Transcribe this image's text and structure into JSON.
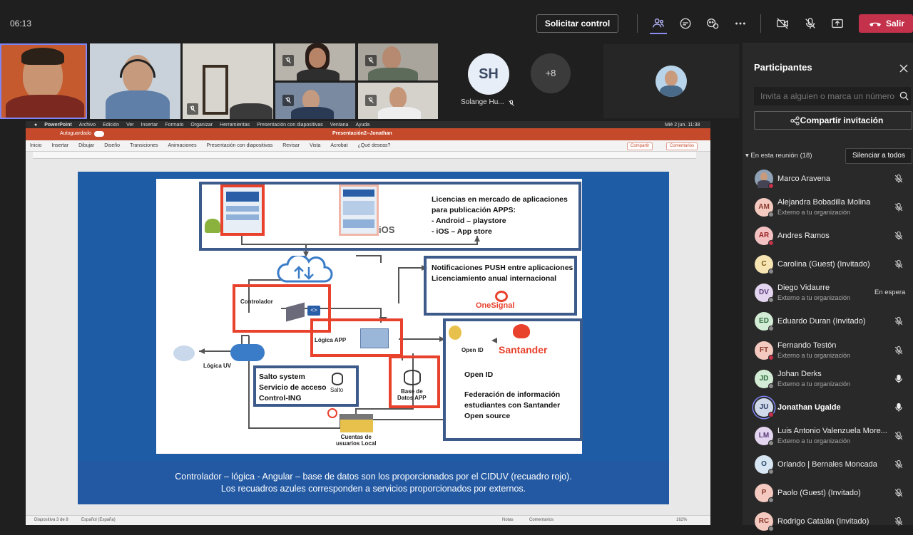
{
  "call": {
    "elapsed": "06:13",
    "request_control_label": "Solicitar control",
    "leave_label": "Salir"
  },
  "video_strip": {
    "shared_avatar_initials": "SH",
    "shared_avatar_name": "Solange Hu...",
    "more_count": "+8"
  },
  "screen_share": {
    "mac_menu": [
      "PowerPoint",
      "Archivo",
      "Edición",
      "Ver",
      "Insertar",
      "Formato",
      "Organizar",
      "Herramientas",
      "Presentación con diapositivas",
      "Ventana",
      "Ayuda"
    ],
    "clock": "Mié 2 jun.  11:38",
    "autosave_label": "Autoguardado",
    "document_title": "Presentación2--Jonathan",
    "ribbon_tabs": [
      "Inicio",
      "Insertar",
      "Dibujar",
      "Diseño",
      "Transiciones",
      "Animaciones",
      "Presentación con diapositivas",
      "Revisar",
      "Vista",
      "Acrobat",
      "¿Qué deseas?"
    ],
    "share_label": "Compartir",
    "comments_label": "Comentarios",
    "status_slide": "Diapositiva 3 de 8",
    "status_language": "Español (España)",
    "status_notes": "Notas",
    "status_comments": "Comentarios",
    "zoom": "162%"
  },
  "slide": {
    "apps_title": "Licencias en mercado de aplicaciones",
    "apps_title2": "para publicación APPS:",
    "apps_item1": "-   Android – playstore",
    "apps_item2": "-   iOS – App store",
    "ios_label": "iOS",
    "push_line1": "Notificaciones PUSH entre aplicaciones",
    "push_line2": "Licenciamiento anual internacional",
    "onesignal_label": "OneSignal",
    "controller_label": "Controlador",
    "logic_app_label": "Lógica APP",
    "open_id_small": "Open ID",
    "santander_label": "Santander",
    "logic_uv_label": "Lógica UV",
    "salto_line1": "Salto system",
    "salto_line2": "Servicio de acceso",
    "salto_line3": "Control-ING",
    "salto_db": "Salto",
    "db_app_line1": "Base de",
    "db_app_line2": "Datos APP",
    "openid_line": "Open ID",
    "fed_line1": "Federación de información",
    "fed_line2": "estudiantes con Santander",
    "fed_line3": "Open source",
    "local_users_line1": "Cuentas de",
    "local_users_line2": "usuarios Local",
    "footer_line1": "Controlador – lógica - Angular – base de datos son los proporcionados por el CIDUV (recuadro rojo).",
    "footer_line2": "Los recuadros azules corresponden a servicios proporcionados por externos."
  },
  "participants": {
    "title": "Participantes",
    "invite_placeholder": "Invita a alguien o marca un número",
    "share_invite_label": "Compartir invitación",
    "section_label": "En esta reunión (18)",
    "mute_all_label": "Silenciar a todos",
    "list": [
      {
        "name": "Marco Aravena",
        "initials": "",
        "subtitle": "",
        "photo": true,
        "avatar_color": "#8fa2b5",
        "status_color": "#c4314b",
        "mic": "muted"
      },
      {
        "name": "Alejandra Bobadilla Molina",
        "initials": "AM",
        "subtitle": "Externo a tu organización",
        "avatar_color": "#f3c9c0",
        "text_color": "#8a3a2c",
        "status_color": "#8a8a8a",
        "mic": "muted"
      },
      {
        "name": "Andres Ramos",
        "initials": "AR",
        "subtitle": "",
        "avatar_color": "#f3c1c1",
        "text_color": "#922",
        "status_color": "#c4314b",
        "mic": "muted"
      },
      {
        "name": "Carolina (Guest) (Invitado)",
        "initials": "C",
        "subtitle": "",
        "avatar_color": "#f6e5b3",
        "text_color": "#7a5a10",
        "status_color": "#8a8a8a",
        "mic": "muted"
      },
      {
        "name": "Diego Vidaurre",
        "initials": "DV",
        "subtitle": "Externo a tu organización",
        "avatar_color": "#e3d5ef",
        "text_color": "#5a3a7a",
        "status_color": "#8a8a8a",
        "mic": "none",
        "wait": "En espera"
      },
      {
        "name": "Eduardo Duran (Invitado)",
        "initials": "ED",
        "subtitle": "",
        "avatar_color": "#d3ecd6",
        "text_color": "#2a6a3a",
        "status_color": "#8a8a8a",
        "mic": "muted"
      },
      {
        "name": "Fernando Testón",
        "initials": "FT",
        "subtitle": "Externo a tu organización",
        "avatar_color": "#f3c9c0",
        "text_color": "#8a3a2c",
        "status_color": "#c4314b",
        "mic": "muted"
      },
      {
        "name": "Johan Derks",
        "initials": "JD",
        "subtitle": "Externo a tu organización",
        "avatar_color": "#d3ecd6",
        "text_color": "#2a6a3a",
        "status_color": "#8a8a8a",
        "mic": "on"
      },
      {
        "name": "Jonathan Ugalde",
        "initials": "JU",
        "subtitle": "",
        "avatar_color": "#cfd9ea",
        "text_color": "#2d3f66",
        "status_color": "#c4314b",
        "mic": "on",
        "active": true
      },
      {
        "name": "Luis Antonio Valenzuela More...",
        "initials": "LM",
        "subtitle": "Externo a tu organización",
        "avatar_color": "#e3d5ef",
        "text_color": "#5a3a7a",
        "status_color": "#8a8a8a",
        "mic": "muted"
      },
      {
        "name": "Orlando | Bernales Moncada",
        "initials": "O",
        "subtitle": "",
        "avatar_color": "#d8e6f3",
        "text_color": "#2a4a6a",
        "status_color": "#8a8a8a",
        "mic": "muted"
      },
      {
        "name": "Paolo (Guest) (Invitado)",
        "initials": "P",
        "subtitle": "",
        "avatar_color": "#f3c9c0",
        "text_color": "#8a3a2c",
        "status_color": "#8a8a8a",
        "mic": "muted"
      },
      {
        "name": "Rodrigo Catalán (Invitado)",
        "initials": "RC",
        "subtitle": "",
        "avatar_color": "#f3c9c0",
        "text_color": "#8a3a2c",
        "status_color": "#8a8a8a",
        "mic": "muted"
      }
    ]
  }
}
